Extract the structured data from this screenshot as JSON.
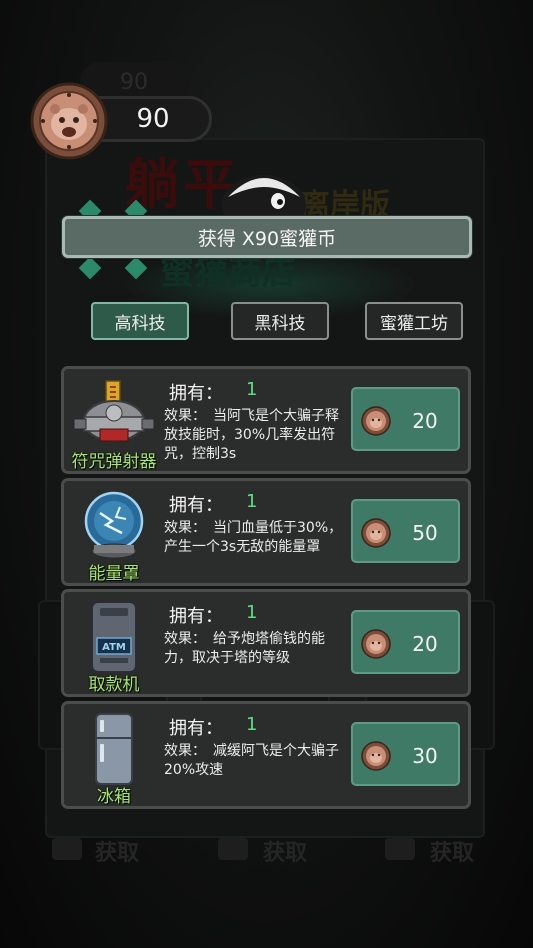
{
  "header": {
    "coin_shadow_count": "90",
    "coin_count": "90"
  },
  "background": {
    "title": "躺平",
    "subtitle": "离岸版",
    "shop_title": "蜜獾商店",
    "card_labels": [
      "获取",
      "获取",
      "获取"
    ]
  },
  "toast": {
    "text": "获得 X90蜜獾币"
  },
  "tabs": [
    {
      "label": "高科技",
      "active": true
    },
    {
      "label": "黑科技",
      "active": false
    },
    {
      "label": "蜜獾工坊",
      "active": false
    }
  ],
  "items": [
    {
      "name": "符咒弹射器",
      "icon": "talisman-launcher-icon",
      "own_label": "拥有：",
      "own_value": "1",
      "effect": "效果：　当阿飞是个大骗子释放技能时，30%几率发出符咒，控制3s",
      "price": "20"
    },
    {
      "name": "能量罩",
      "icon": "energy-shield-icon",
      "own_label": "拥有：",
      "own_value": "1",
      "effect": "效果：　当门血量低于30%，产生一个3s无敌的能量罩",
      "price": "50"
    },
    {
      "name": "取款机",
      "icon": "atm-icon",
      "icon_text": "ATM",
      "own_label": "拥有：",
      "own_value": "1",
      "effect": "效果：　给予炮塔偷钱的能力，取决于塔的等级",
      "price": "20"
    },
    {
      "name": "冰箱",
      "icon": "fridge-icon",
      "own_label": "拥有：",
      "own_value": "1",
      "effect": "效果：　减缓阿飞是个大骗子20%攻速",
      "price": "30"
    }
  ],
  "colors": {
    "accent_green": "#3f7a67",
    "item_name_green": "#a6e86a",
    "own_value_green": "#5ce07a",
    "toast_bg": "#5a6a64"
  }
}
